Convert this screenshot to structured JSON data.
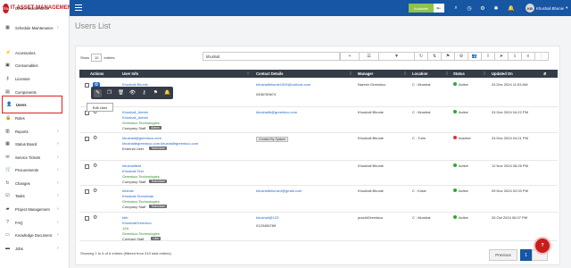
{
  "app": {
    "logo_badge": "ITG",
    "logo_text": "IT ASSET MANAGEMENT",
    "availability": "Available",
    "user_initials": "KB",
    "user_name": "Khushali Bhunie"
  },
  "sidebar": {
    "items": [
      {
        "label": "Device Maintenance",
        "icon": "wrench-icon",
        "chev": ""
      },
      {
        "label": "Schedule Maintenance",
        "icon": "calendar-icon",
        "chev": "›"
      },
      {
        "label": "Accessories",
        "icon": "plug-icon",
        "chev": ""
      },
      {
        "label": "Consumables",
        "icon": "box-icon",
        "chev": ""
      },
      {
        "label": "Licenses",
        "icon": "key-icon",
        "chev": ""
      },
      {
        "label": "Components",
        "icon": "chip-icon",
        "chev": ""
      },
      {
        "label": "Users",
        "icon": "user-icon",
        "chev": ""
      },
      {
        "label": "Roles",
        "icon": "lock-icon",
        "chev": ""
      },
      {
        "label": "Reports",
        "icon": "chart-icon",
        "chev": "›"
      },
      {
        "label": "Status Board",
        "icon": "board-icon",
        "chev": "›"
      },
      {
        "label": "Service Tickets",
        "icon": "ticket-icon",
        "chev": "›"
      },
      {
        "label": "Procurements",
        "icon": "cart-icon",
        "chev": "›"
      },
      {
        "label": "Changes",
        "icon": "refresh-icon",
        "chev": "›"
      },
      {
        "label": "Tasks",
        "icon": "tasks-icon",
        "chev": "›"
      },
      {
        "label": "Project Management",
        "icon": "folder-icon",
        "chev": "›"
      },
      {
        "label": "FAQ",
        "icon": "question-icon",
        "chev": "›"
      },
      {
        "label": "Knowledge Document",
        "icon": "book-icon",
        "chev": "›"
      },
      {
        "label": "Jobs",
        "icon": "briefcase-icon",
        "chev": "›"
      }
    ]
  },
  "page": {
    "title": "Users List"
  },
  "table": {
    "show_label": "Show",
    "entries_value": "10",
    "entries_label": "entries",
    "search_value": "khushali",
    "columns": {
      "actions": "Actions",
      "user_info": "User Info",
      "contact": "Contact Details",
      "manager": "Manager",
      "location": "Location",
      "status": "Status",
      "updated": "Updated On"
    },
    "rows": [
      {
        "name": "Khushali Bhunie",
        "line2": "",
        "company": "",
        "role": "",
        "email": "khushalibhunie1009@outlook.com",
        "phone": "0456789674",
        "manager": "Naresh Greenkco",
        "location": "C : Mumbai",
        "status": "Active",
        "updated": "24 Dec 2024 11:53 AM"
      },
      {
        "name": "Khushali_Admin",
        "line2": "Khushali_Admin",
        "company": "Greenkco Technologies",
        "role": "Company Staff",
        "tag": "Admin",
        "email": "khushalib@greenkco.com",
        "phone": "",
        "manager": "Khushali Bhunie",
        "location": "C : Mumbai",
        "status": "Active",
        "updated": "24 Dec 2024 04:22 PM"
      },
      {
        "name": "khushali@greenkco.com",
        "line2": "khushalibgreenkco.com.khushalibgreenkco.com",
        "company": "",
        "role": "External User",
        "tag": "Technician",
        "email": "Created By System",
        "phone": "",
        "manager": "Khushali Bhunie",
        "location": "C : Turin",
        "status": "Inactive",
        "updated": "24 Dec 2024 04:21 PM"
      },
      {
        "name": "khushalitest",
        "line2": "Khushali Test",
        "company": "Greenkco Technologies",
        "role": "Company Staff",
        "tag": "Technician",
        "email": "",
        "phone": "",
        "manager": "Khushali Bhunie",
        "location": "",
        "status": "Active",
        "updated": "12 Nov 2024 06:26 PM"
      },
      {
        "name": "khshali",
        "line2": "Khushali Technician",
        "company": "Greenkco Technologies",
        "role": "Company Staff",
        "tag": "Technician",
        "email": "khushalibhunie4@gmail.com",
        "phone": "",
        "manager": "Khushali Bhunie",
        "location": "C : Kotar",
        "status": "Active",
        "updated": "09 Nov 2024 02:00 PM"
      },
      {
        "name": "kbb",
        "line2": "KhushaliGreenkco",
        "company": "12A",
        "role": "Greenkco Technologies",
        "role2": "Contract Staff",
        "tag": "User",
        "email": "khushali@123",
        "phone": "0123456789",
        "manager": "prachiGreenkco",
        "location": "C : Mumbai",
        "status": "Active",
        "updated": "26 Oct 2024 06:07 PM"
      }
    ],
    "showing": "Showing 1 to 6 of 6 entries (filtered from 319 total entries)",
    "prev_label": "Previous",
    "page_label": "1"
  },
  "popup": {
    "tooltip": "Edit User"
  },
  "colors": {
    "primary": "#1656a3",
    "header": "#353c47",
    "active": "#2fa82f",
    "inactive": "#e03131",
    "accent_red": "#c81d1d"
  }
}
